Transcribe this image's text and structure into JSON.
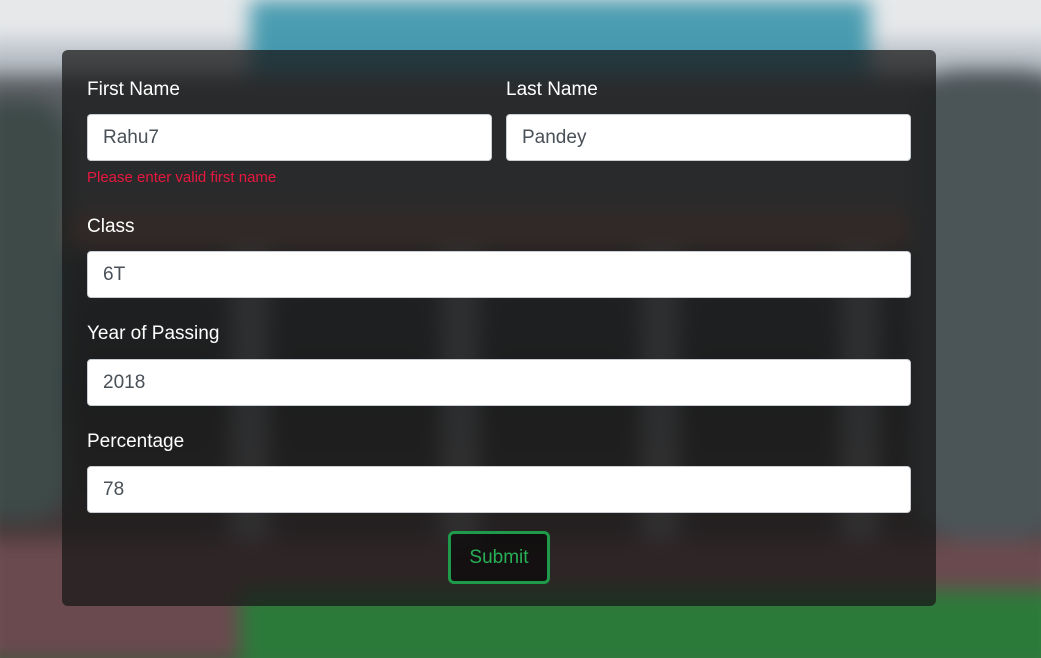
{
  "form": {
    "first_name": {
      "label": "First Name",
      "value": "Rahu7",
      "error": "Please enter valid first name"
    },
    "last_name": {
      "label": "Last Name",
      "value": "Pandey"
    },
    "class": {
      "label": "Class",
      "value": "6T"
    },
    "year_of_passing": {
      "label": "Year of Passing",
      "value": "2018"
    },
    "percentage": {
      "label": "Percentage",
      "value": "78"
    },
    "submit_label": "Submit"
  },
  "colors": {
    "error_text": "#e8173f",
    "submit_accent": "#1f9a4a",
    "card_overlay": "#181818"
  }
}
